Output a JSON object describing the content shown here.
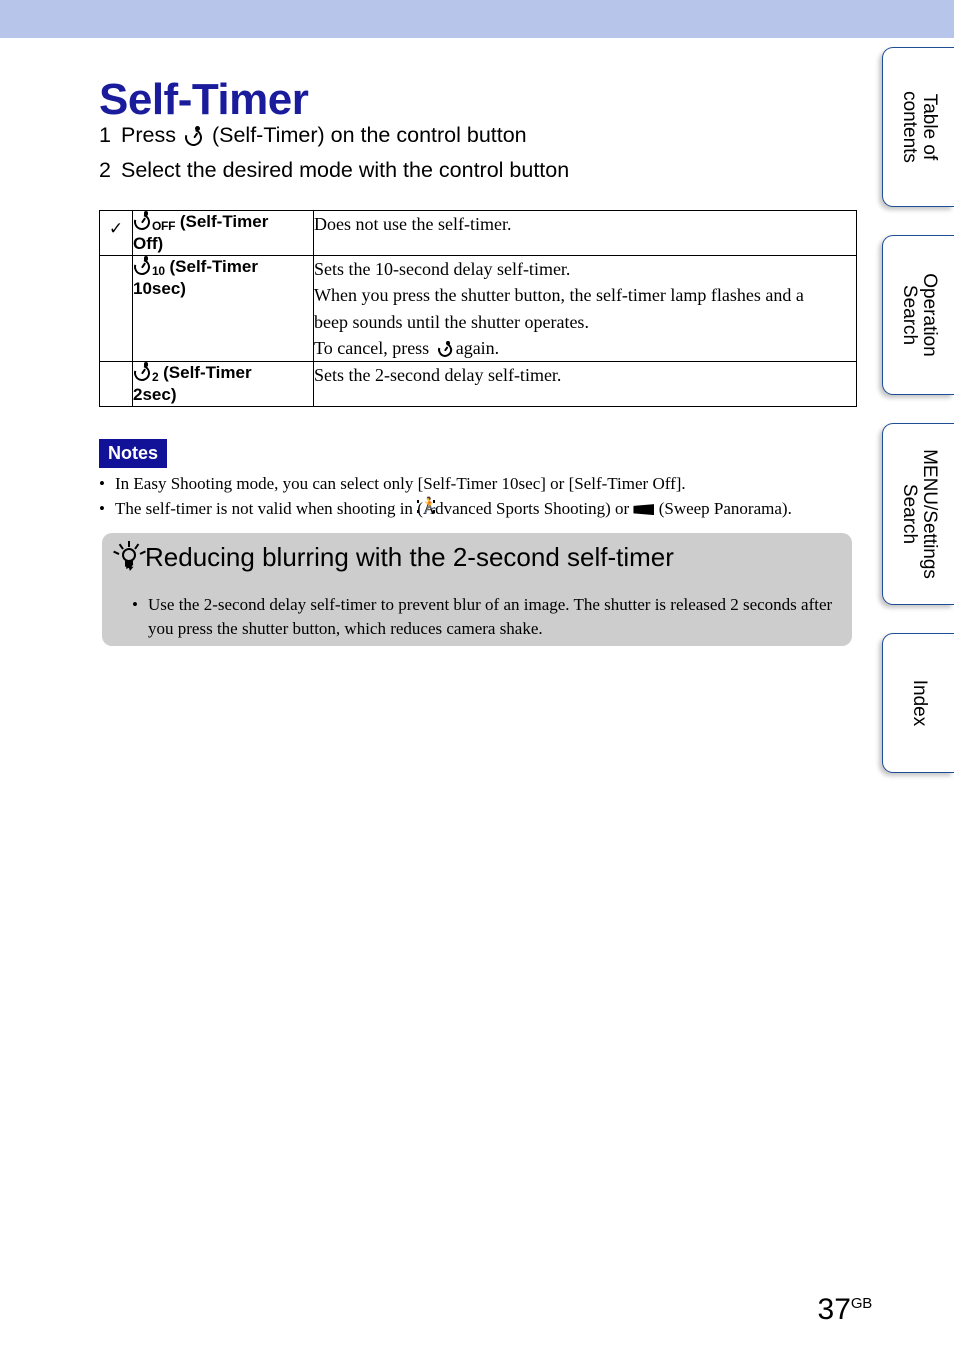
{
  "document": {
    "page_title": "Self-Timer",
    "page_number": "37",
    "page_number_suffix": "GB"
  },
  "steps": [
    {
      "num": "1",
      "before_icon": "Press",
      "icon": "self-timer-icon",
      "after_icon": "(Self-Timer) on the control button"
    },
    {
      "num": "2",
      "before_icon": "Select the desired mode with the control button",
      "icon": "",
      "after_icon": ""
    }
  ],
  "mode_table": {
    "rows": [
      {
        "checked": true,
        "check_glyph": "✓",
        "icon": "self-timer-icon",
        "icon_subscript": "OFF",
        "label": "(Self-Timer Off)",
        "label_line1": "(Self-Timer",
        "label_line2": "Off)",
        "description_lines": [
          "Does not use the self-timer."
        ]
      },
      {
        "checked": false,
        "check_glyph": "",
        "icon": "self-timer-icon",
        "icon_subscript": "10",
        "label": "(Self-Timer 10sec)",
        "label_line1": "(Self-Timer",
        "label_line2": "10sec)",
        "description_lines": [
          "Sets the 10-second delay self-timer.",
          "When you press the shutter button, the self-timer lamp flashes and a",
          "beep sounds until the shutter operates.",
          "To cancel, press  again."
        ],
        "cancel_prefix": "To cancel, press",
        "cancel_suffix": "again."
      },
      {
        "checked": false,
        "check_glyph": "",
        "icon": "self-timer-icon",
        "icon_subscript": "2",
        "label": "(Self-Timer 2sec)",
        "label_line1": "(Self-Timer",
        "label_line2": "2sec)",
        "description_lines": [
          "Sets the 2-second delay self-timer."
        ]
      }
    ]
  },
  "notes": {
    "badge": "Notes",
    "bullet": "•",
    "items": [
      {
        "text": "In Easy Shooting mode, you can select only [Self-Timer 10sec] or [Self-Timer Off]."
      },
      {
        "prefix": "The self-timer is not valid when shooting in",
        "icon1": "advanced-sports-shooting-icon",
        "middle": "(Advanced Sports Shooting) or",
        "icon2": "sweep-panorama-icon",
        "suffix": "(Sweep Panorama)."
      }
    ]
  },
  "tip": {
    "icon": "lightbulb-icon",
    "title": "Reducing blurring with the 2-second self-timer",
    "bullet": "•",
    "body_lines": [
      "Use the 2-second delay self-timer to prevent blur of an image. The shutter is released 2 seconds after",
      "you press the shutter button, which reduces camera shake."
    ]
  },
  "side_tabs": [
    {
      "id": "toc",
      "label": "Table of\ncontents",
      "line1": "Table of",
      "line2": "contents"
    },
    {
      "id": "op",
      "label": "Operation\nSearch",
      "line1": "Operation",
      "line2": "Search"
    },
    {
      "id": "menu",
      "label": "MENU/Settings\nSearch",
      "line1": "MENU/Settings",
      "line2": "Search"
    },
    {
      "id": "index",
      "label": "Index",
      "line1": "Index",
      "line2": ""
    }
  ],
  "colors": {
    "top_band": "#b7c5ea",
    "title": "#1b1c9c",
    "notes_badge_bg": "#121298",
    "tip_bg": "#cdcdcd",
    "tab_border": "#1f4e96"
  }
}
